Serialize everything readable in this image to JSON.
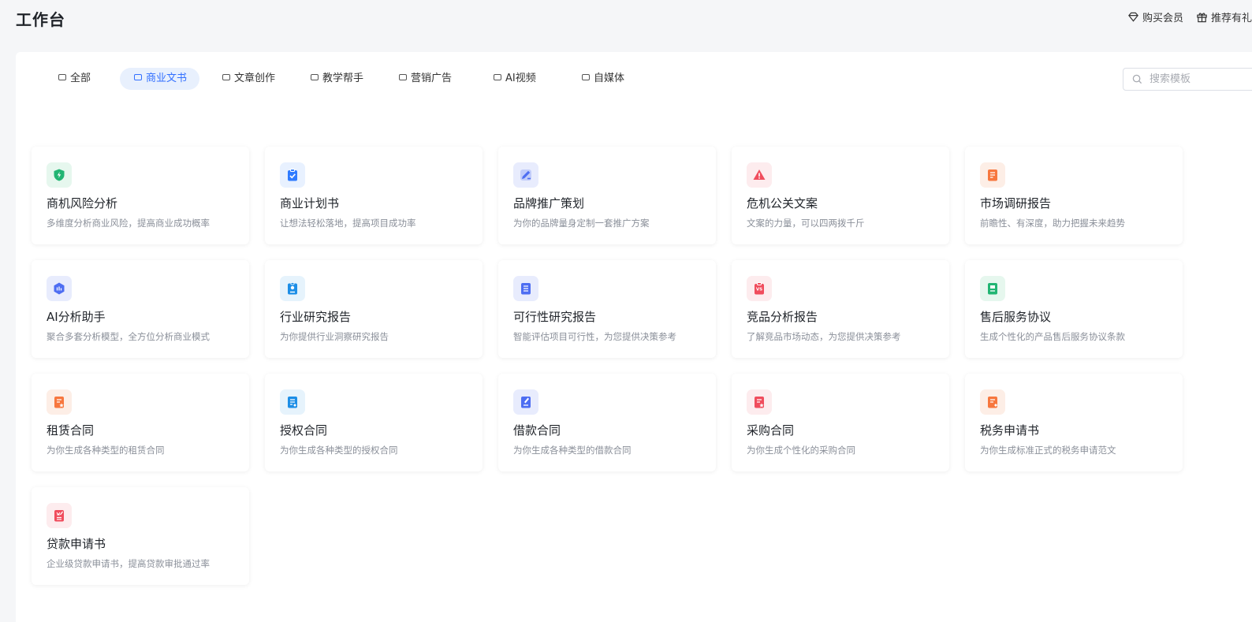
{
  "header": {
    "title": "工作台",
    "actions": [
      {
        "label": "购买会员",
        "icon": "diamond-icon"
      },
      {
        "label": "推荐有礼",
        "icon": "gift-icon"
      }
    ]
  },
  "tabs": [
    {
      "label": "全部"
    },
    {
      "label": "商业文书",
      "active": true
    },
    {
      "label": "文章创作"
    },
    {
      "label": "教学帮手"
    },
    {
      "label": "营销广告"
    },
    {
      "label": "AI视频"
    },
    {
      "label": "自媒体"
    }
  ],
  "search": {
    "placeholder": "搜索模板",
    "value": ""
  },
  "cards": [
    {
      "title": "商机风险分析",
      "desc": "多维度分析商业风险，提高商业成功概率",
      "icon": "shield-icon",
      "color": "#22b573",
      "bg": "#e6f7ee"
    },
    {
      "title": "商业计划书",
      "desc": "让想法轻松落地，提高项目成功率",
      "icon": "clipboard-check-icon",
      "color": "#2f7bff",
      "bg": "#e8f1ff"
    },
    {
      "title": "品牌推广策划",
      "desc": "为你的品牌量身定制一套推广方案",
      "icon": "pencil-icon",
      "color": "#4e6ef2",
      "bg": "#e8ecfd"
    },
    {
      "title": "危机公关文案",
      "desc": "文案的力量，可以四两拨千斤",
      "icon": "warning-icon",
      "color": "#f04d5d",
      "bg": "#fdecee"
    },
    {
      "title": "市场调研报告",
      "desc": "前瞻性、有深度，助力把握未来趋势",
      "icon": "report-icon",
      "color": "#f7773e",
      "bg": "#fdeee6"
    },
    {
      "title": "AI分析助手",
      "desc": "聚合多套分析模型，全方位分析商业模式",
      "icon": "hexagon-chart-icon",
      "color": "#4e6ef2",
      "bg": "#e8ecfd"
    },
    {
      "title": "行业研究报告",
      "desc": "为你提供行业洞察研究报告",
      "icon": "badge-icon",
      "color": "#1d8ee6",
      "bg": "#e6f3fc"
    },
    {
      "title": "可行性研究报告",
      "desc": "智能评估项目可行性，为您提供决策参考",
      "icon": "checklist-icon",
      "color": "#4e6ef2",
      "bg": "#e8ecfd"
    },
    {
      "title": "竞品分析报告",
      "desc": "了解竞品市场动态，为您提供决策参考",
      "icon": "versus-icon",
      "color": "#f04d5d",
      "bg": "#fdecee"
    },
    {
      "title": "售后服务协议",
      "desc": "生成个性化的产品售后服务协议条款",
      "icon": "agreement-icon",
      "color": "#22b573",
      "bg": "#e6f7ee"
    },
    {
      "title": "租赁合同",
      "desc": "为你生成各种类型的租赁合同",
      "icon": "contract-star-icon",
      "color": "#f7773e",
      "bg": "#fdeee6"
    },
    {
      "title": "授权合同",
      "desc": "为你生成各种类型的授权合同",
      "icon": "contract-icon",
      "color": "#1d8ee6",
      "bg": "#e6f3fc"
    },
    {
      "title": "借款合同",
      "desc": "为你生成各种类型的借款合同",
      "icon": "doc-edit-icon",
      "color": "#4e6ef2",
      "bg": "#e8ecfd"
    },
    {
      "title": "采购合同",
      "desc": "为你生成个性化的采购合同",
      "icon": "contract-star-icon",
      "color": "#f04d5d",
      "bg": "#fdecee"
    },
    {
      "title": "税务申请书",
      "desc": "为你生成标准正式的税务申请范文",
      "icon": "tax-doc-icon",
      "color": "#f7773e",
      "bg": "#fdeee6"
    },
    {
      "title": "贷款申请书",
      "desc": "企业级贷款申请书，提高贷款审批通过率",
      "icon": "loan-doc-icon",
      "color": "#f04d5d",
      "bg": "#fdecee"
    }
  ]
}
